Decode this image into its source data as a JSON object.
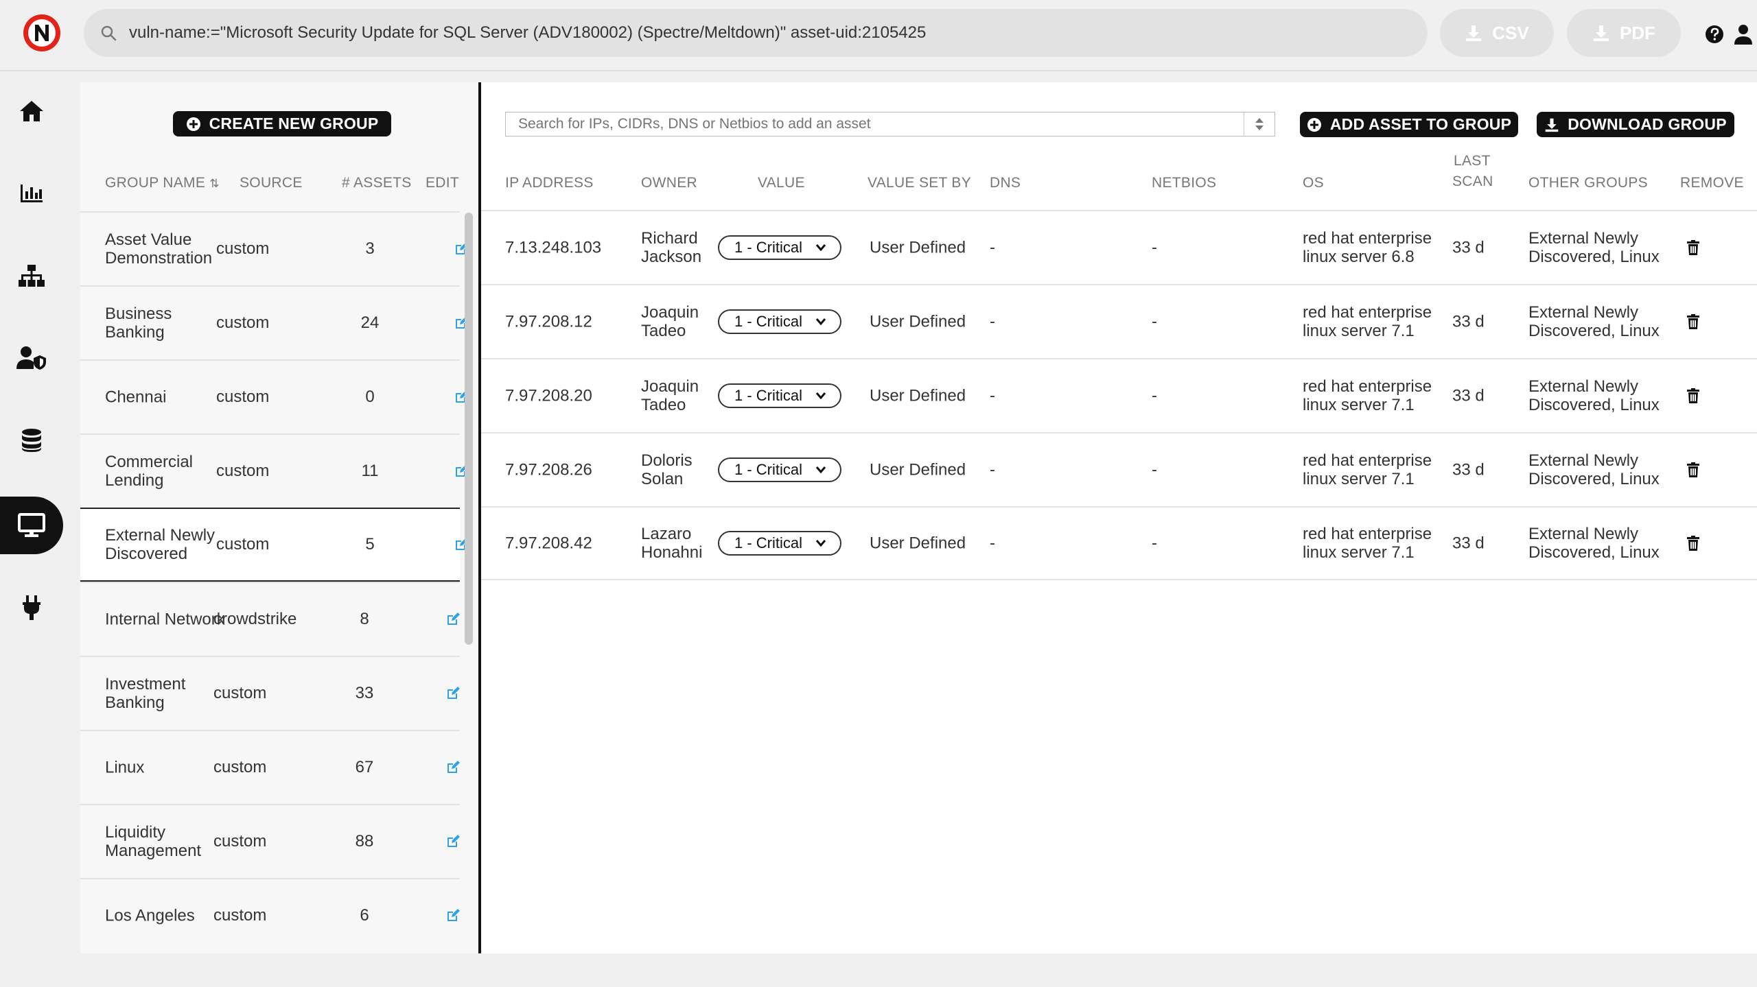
{
  "header": {
    "search_value": "vuln-name:=\"Microsoft Security Update for SQL Server (ADV180002) (Spectre/Meltdown)\" asset-uid:2105425",
    "csv_label": "CSV",
    "pdf_label": "PDF",
    "logo_letter": "N"
  },
  "colors": {
    "accent_red": "#e2231a",
    "edit_icon": "#2ea3e0",
    "dark_button": "#111111"
  },
  "sidebar": {
    "items": [
      {
        "icon": "home-icon"
      },
      {
        "icon": "bar-chart-icon"
      },
      {
        "icon": "network-icon"
      },
      {
        "icon": "user-shield-icon"
      },
      {
        "icon": "database-icon"
      },
      {
        "icon": "monitor-icon",
        "active": true
      },
      {
        "icon": "plug-icon"
      }
    ]
  },
  "groups": {
    "create_label": "CREATE NEW GROUP",
    "columns": {
      "name": "GROUP NAME",
      "source": "SOURCE",
      "assets": "# ASSETS",
      "edit": "EDIT"
    },
    "rows": [
      {
        "name": "Asset Value Demonstration",
        "source": "custom",
        "assets": "3"
      },
      {
        "name": "Business Banking",
        "source": "custom",
        "assets": "24"
      },
      {
        "name": "Chennai",
        "source": "custom",
        "assets": "0"
      },
      {
        "name": "Commercial Lending",
        "source": "custom",
        "assets": "11"
      },
      {
        "name": "External Newly Discovered",
        "source": "custom",
        "assets": "5",
        "selected": true
      },
      {
        "name": "Internal Network",
        "source": "crowdstrike",
        "assets": "8"
      },
      {
        "name": "Investment Banking",
        "source": "custom",
        "assets": "33"
      },
      {
        "name": "Linux",
        "source": "custom",
        "assets": "67"
      },
      {
        "name": "Liquidity Management",
        "source": "custom",
        "assets": "88"
      },
      {
        "name": "Los Angeles",
        "source": "custom",
        "assets": "6"
      }
    ]
  },
  "assets": {
    "search_placeholder": "Search for IPs, CIDRs, DNS or Netbios to add an asset",
    "add_label": "ADD ASSET TO GROUP",
    "download_label": "DOWNLOAD GROUP",
    "columns": {
      "ip": "IP ADDRESS",
      "owner": "OWNER",
      "value": "VALUE",
      "value_set_by": "VALUE SET BY",
      "dns": "DNS",
      "netbios": "NETBIOS",
      "os": "OS",
      "last_scan_1": "LAST",
      "last_scan_2": "SCAN",
      "other_groups": "OTHER GROUPS",
      "remove": "REMOVE"
    },
    "rows": [
      {
        "ip": "7.13.248.103",
        "owner": "Richard Jackson",
        "value": "1 - Critical",
        "value_set_by": "User Defined",
        "dns": "-",
        "netbios": "-",
        "os": "red hat enterprise linux server 6.8",
        "last_scan": "33 d",
        "other_groups": "External Newly Discovered, Linux"
      },
      {
        "ip": "7.97.208.12",
        "owner": "Joaquin Tadeo",
        "value": "1 - Critical",
        "value_set_by": "User Defined",
        "dns": "-",
        "netbios": "-",
        "os": "red hat enterprise linux server 7.1",
        "last_scan": "33 d",
        "other_groups": "External Newly Discovered, Linux"
      },
      {
        "ip": "7.97.208.20",
        "owner": "Joaquin Tadeo",
        "value": "1 - Critical",
        "value_set_by": "User Defined",
        "dns": "-",
        "netbios": "-",
        "os": "red hat enterprise linux server 7.1",
        "last_scan": "33 d",
        "other_groups": "External Newly Discovered, Linux"
      },
      {
        "ip": "7.97.208.26",
        "owner": "Doloris Solan",
        "value": "1 - Critical",
        "value_set_by": "User Defined",
        "dns": "-",
        "netbios": "-",
        "os": "red hat enterprise linux server 7.1",
        "last_scan": "33 d",
        "other_groups": "External Newly Discovered, Linux"
      },
      {
        "ip": "7.97.208.42",
        "owner": "Lazaro Honahni",
        "value": "1 - Critical",
        "value_set_by": "User Defined",
        "dns": "-",
        "netbios": "-",
        "os": "red hat enterprise linux server 7.1",
        "last_scan": "33 d",
        "other_groups": "External Newly Discovered, Linux"
      }
    ]
  }
}
